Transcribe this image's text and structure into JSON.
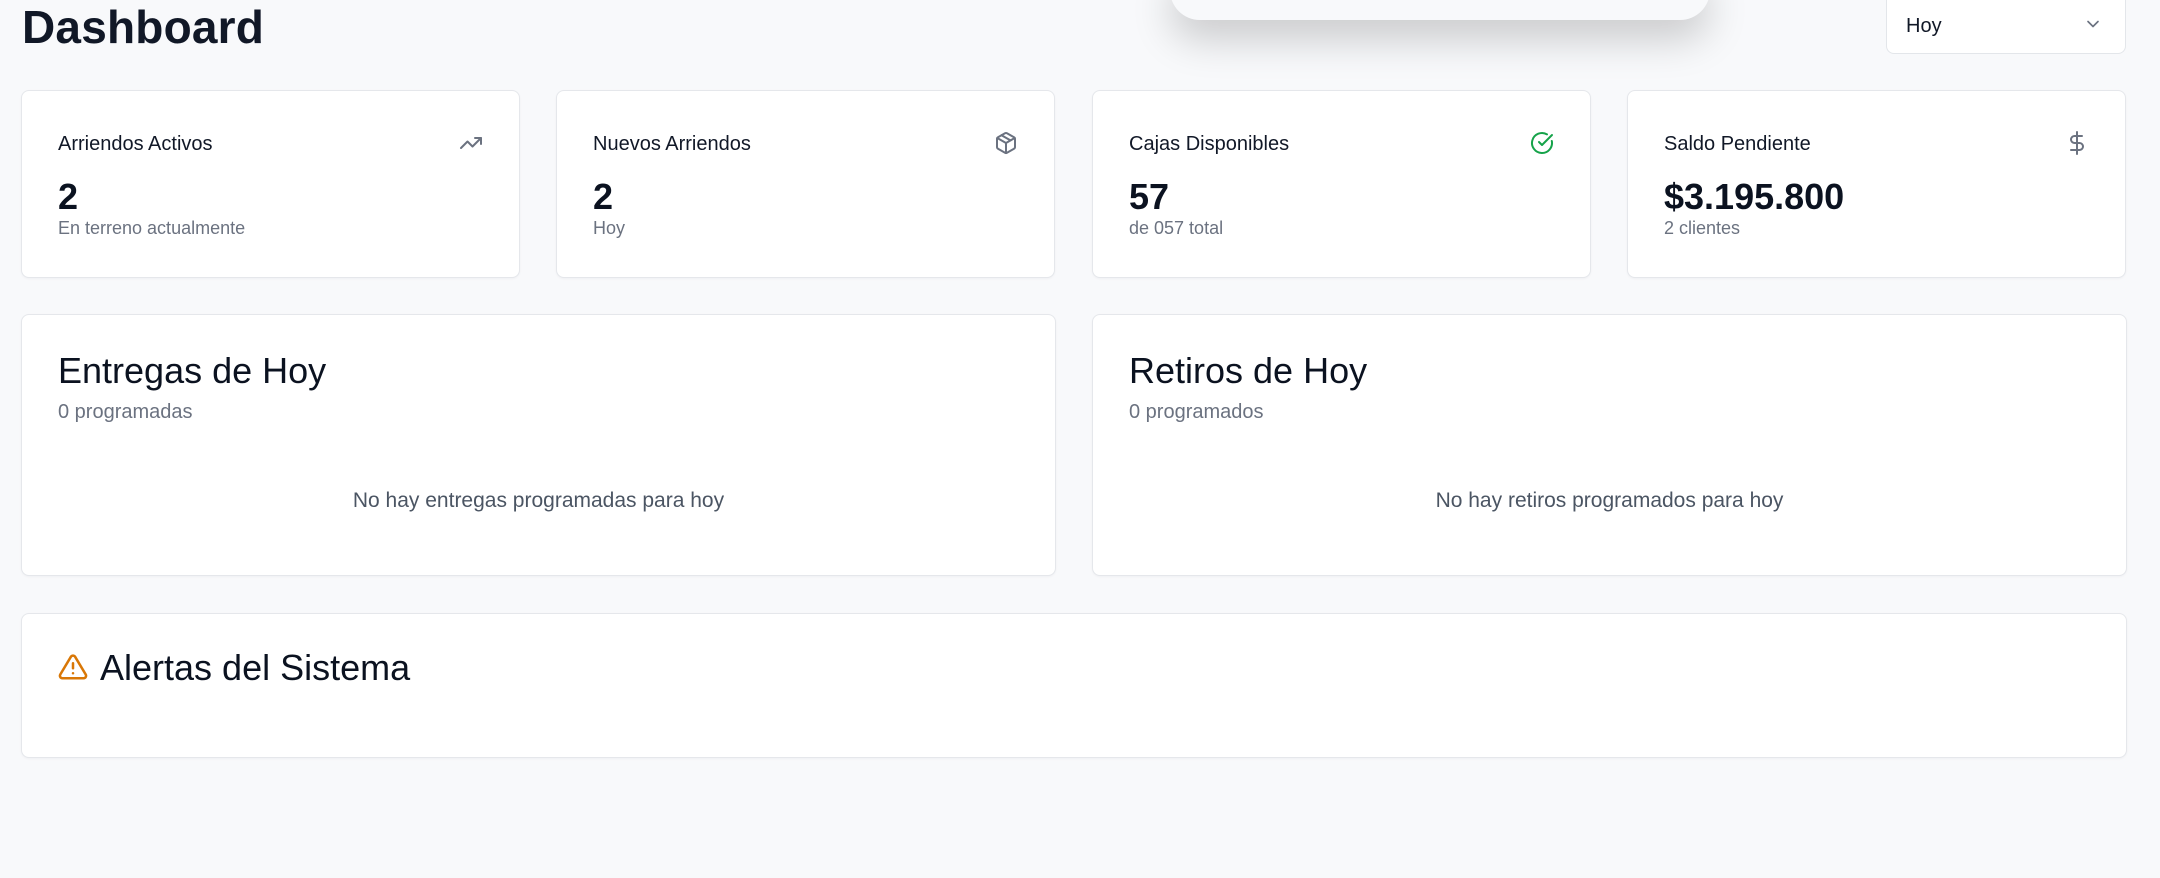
{
  "header": {
    "title": "Dashboard",
    "period_select": {
      "selected": "Hoy"
    }
  },
  "stats": [
    {
      "label": "Arriendos Activos",
      "value": "2",
      "sub": "En terreno actualmente",
      "icon": "trending-up-icon",
      "icon_color": "#6b7280"
    },
    {
      "label": "Nuevos Arriendos",
      "value": "2",
      "sub": "Hoy",
      "icon": "package-icon",
      "icon_color": "#6b7280"
    },
    {
      "label": "Cajas Disponibles",
      "value": "57",
      "sub": "de 057 total",
      "icon": "check-circle-icon",
      "icon_color": "#16a34a"
    },
    {
      "label": "Saldo Pendiente",
      "value": "$3.195.800",
      "sub": "2 clientes",
      "icon": "dollar-sign-icon",
      "icon_color": "#6b7280"
    }
  ],
  "deliveries": {
    "title": "Entregas de Hoy",
    "subtitle": "0 programadas",
    "empty_message": "No hay entregas programadas para hoy"
  },
  "pickups": {
    "title": "Retiros de Hoy",
    "subtitle": "0 programados",
    "empty_message": "No hay retiros programados para hoy"
  },
  "alerts": {
    "title": "Alertas del Sistema",
    "icon": "alert-triangle-icon",
    "icon_color": "#d97706"
  }
}
